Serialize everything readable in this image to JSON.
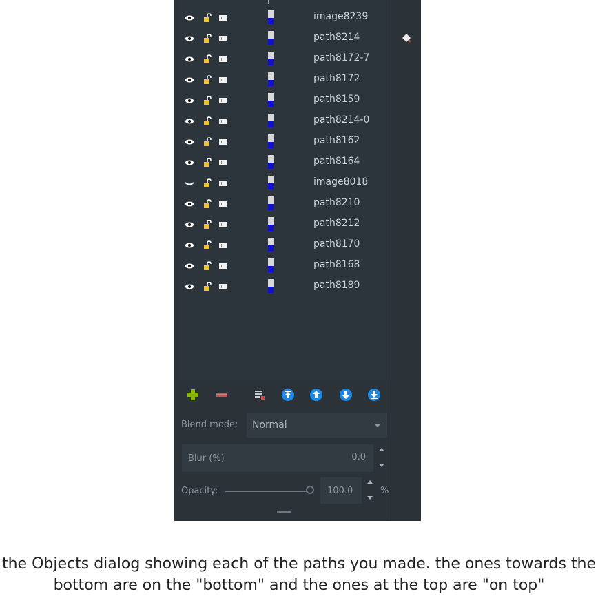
{
  "objects_panel": {
    "rows": [
      {
        "name": "image8239",
        "visibility": "visible"
      },
      {
        "name": "path8214",
        "visibility": "visible"
      },
      {
        "name": "path8172-7",
        "visibility": "visible"
      },
      {
        "name": "path8172",
        "visibility": "visible"
      },
      {
        "name": "path8159",
        "visibility": "visible"
      },
      {
        "name": "path8214-0",
        "visibility": "visible"
      },
      {
        "name": "path8162",
        "visibility": "visible"
      },
      {
        "name": "path8164",
        "visibility": "visible"
      },
      {
        "name": "image8018",
        "visibility": "hidden"
      },
      {
        "name": "path8210",
        "visibility": "visible"
      },
      {
        "name": "path8212",
        "visibility": "visible"
      },
      {
        "name": "path8170",
        "visibility": "visible"
      },
      {
        "name": "path8168",
        "visibility": "visible"
      },
      {
        "name": "path8189",
        "visibility": "visible"
      }
    ],
    "toolbar_icons": [
      "add-icon",
      "remove-icon",
      "edit-icon",
      "raise-to-top-icon",
      "raise-icon",
      "lower-icon",
      "lower-to-bottom-icon"
    ],
    "blend_mode_label": "Blend mode:",
    "blend_mode_value": "Normal",
    "blur_label": "Blur (%)",
    "blur_value": "0.0",
    "opacity_label": "Opacity:",
    "opacity_value": "100.0",
    "opacity_unit": "%",
    "opacity_level": 1.0
  },
  "caption": "the Objects dialog showing each of the paths you made. the ones towards the bottom are on the \"bottom\" and the ones at the top are \"on top\"",
  "colors": {
    "panel_bg": "#2b3238",
    "text": "#c9d2d8",
    "accent_blue": "#1e88e5",
    "add_green": "#8ab800",
    "lock_yellow": "#e8c43a"
  }
}
